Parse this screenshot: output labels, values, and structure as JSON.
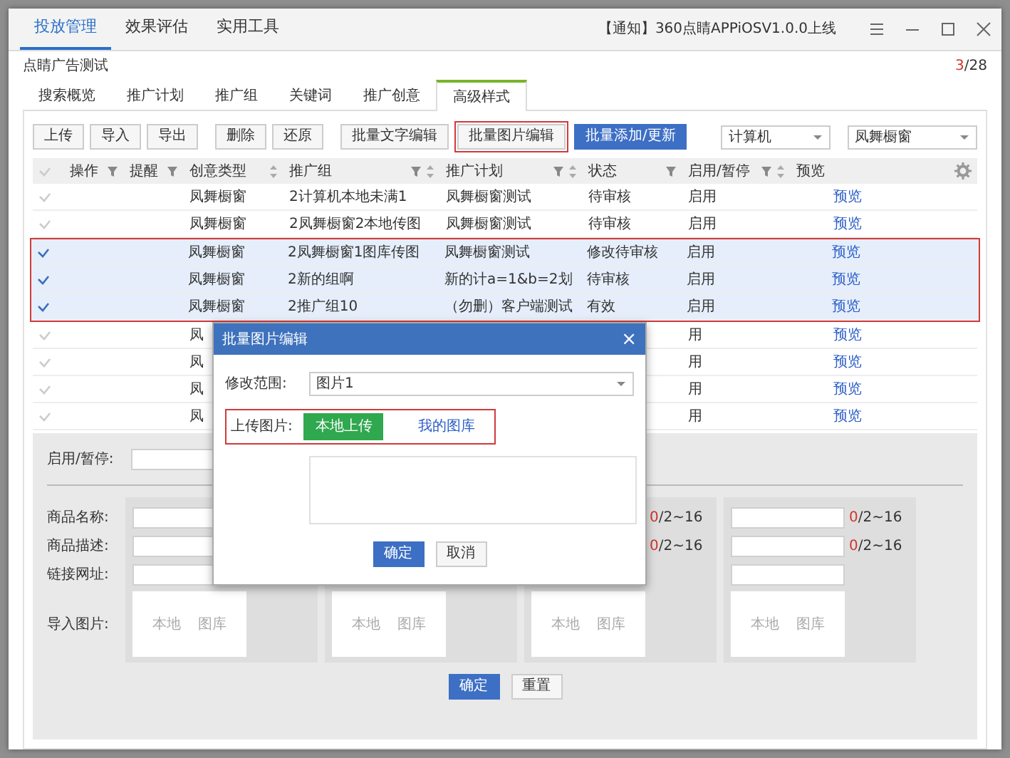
{
  "top_tabs": [
    {
      "label": "投放管理",
      "selected": true
    },
    {
      "label": "效果评估",
      "selected": false
    },
    {
      "label": "实用工具",
      "selected": false
    }
  ],
  "notice": "【通知】360点睛APPiOSV1.0.0上线",
  "account": {
    "name": "点睛广告测试",
    "page_current": "3",
    "page_total": "/28"
  },
  "sub_tabs": [
    {
      "label": "搜索概览",
      "selected": false
    },
    {
      "label": "推广计划",
      "selected": false
    },
    {
      "label": "推广组",
      "selected": false
    },
    {
      "label": "关键词",
      "selected": false
    },
    {
      "label": "推广创意",
      "selected": false
    },
    {
      "label": "高级样式",
      "selected": true
    }
  ],
  "toolbar": {
    "groups": [
      [
        {
          "label": "上传",
          "kind": "default"
        },
        {
          "label": "导入",
          "kind": "default"
        },
        {
          "label": "导出",
          "kind": "default"
        }
      ],
      [
        {
          "label": "删除",
          "kind": "default"
        },
        {
          "label": "还原",
          "kind": "default"
        }
      ],
      [
        {
          "label": "批量文字编辑",
          "kind": "default"
        },
        {
          "label": "批量图片编辑",
          "kind": "callout"
        },
        {
          "label": "批量添加/更新",
          "kind": "primary"
        }
      ]
    ],
    "selects": [
      "计算机",
      "凤舞橱窗"
    ]
  },
  "table": {
    "columns": [
      {
        "label": "操作",
        "filter": true,
        "sort": false
      },
      {
        "label": "提醒",
        "filter": true,
        "sort": false
      },
      {
        "label": "创意类型",
        "filter": false,
        "sort": true
      },
      {
        "label": "推广组",
        "filter": true,
        "sort": true
      },
      {
        "label": "推广计划",
        "filter": true,
        "sort": true
      },
      {
        "label": "状态",
        "filter": true,
        "sort": false
      },
      {
        "label": "启用/暂停",
        "filter": true,
        "sort": true
      },
      {
        "label": "预览",
        "filter": false,
        "sort": false
      }
    ],
    "rows": [
      {
        "selected": false,
        "callout": false,
        "creative_type": "凤舞橱窗",
        "group": "2计算机本地未满1",
        "plan": "凤舞橱窗测试",
        "status": "待审核",
        "enabled": "启用",
        "preview": "预览"
      },
      {
        "selected": false,
        "callout": false,
        "creative_type": "凤舞橱窗",
        "group": "2凤舞橱窗2本地传图",
        "plan": "凤舞橱窗测试",
        "status": "待审核",
        "enabled": "启用",
        "preview": "预览"
      },
      {
        "selected": true,
        "callout": true,
        "creative_type": "凤舞橱窗",
        "group": "2凤舞橱窗1图库传图",
        "plan": "凤舞橱窗测试",
        "status": "修改待审核",
        "enabled": "启用",
        "preview": "预览"
      },
      {
        "selected": true,
        "callout": true,
        "creative_type": "凤舞橱窗",
        "group": "2新的组啊",
        "plan": "新的计a=1&b=2划",
        "status": "待审核",
        "enabled": "启用",
        "preview": "预览"
      },
      {
        "selected": true,
        "callout": true,
        "creative_type": "凤舞橱窗",
        "group": "2推广组10",
        "plan": "（勿删）客户端测试",
        "status": "有效",
        "enabled": "启用",
        "preview": "预览"
      },
      {
        "selected": false,
        "callout": false,
        "creative_type": "凤",
        "enabled": "用",
        "preview": "预览"
      },
      {
        "selected": false,
        "callout": false,
        "creative_type": "凤",
        "enabled": "用",
        "preview": "预览"
      },
      {
        "selected": false,
        "callout": false,
        "creative_type": "凤",
        "enabled": "用",
        "preview": "预览"
      },
      {
        "selected": false,
        "callout": false,
        "creative_type": "凤",
        "enabled": "用",
        "preview": "预览"
      }
    ]
  },
  "edit_panel": {
    "enable_label": "启用/暂停:",
    "field_labels": [
      "商品名称:",
      "商品描述:",
      "链接网址:",
      "导入图片:"
    ],
    "groups": [
      {
        "image_options": [
          "本地",
          "图库"
        ]
      },
      {
        "image_options": [
          "本地",
          "图库"
        ]
      },
      {
        "counters": [
          {
            "used": "0",
            "limit": "/2~16"
          },
          {
            "used": "0",
            "limit": "/2~16"
          }
        ],
        "image_options": [
          "本地",
          "图库"
        ]
      },
      {
        "counters": [
          {
            "used": "0",
            "limit": "/2~16"
          },
          {
            "used": "0",
            "limit": "/2~16"
          }
        ],
        "image_options": [
          "本地",
          "图库"
        ]
      }
    ],
    "buttons": [
      {
        "label": "确定",
        "kind": "primary"
      },
      {
        "label": "重置",
        "kind": "default"
      }
    ]
  },
  "dialog": {
    "title": "批量图片编辑",
    "close": "×",
    "scope_label": "修改范围:",
    "scope_value": "图片1",
    "upload_label": "上传图片:",
    "upload_button": "本地上传",
    "library_link": "我的图库",
    "upload_callout": true,
    "buttons": [
      {
        "label": "确定",
        "kind": "primary"
      },
      {
        "label": "取消",
        "kind": "default"
      }
    ]
  }
}
